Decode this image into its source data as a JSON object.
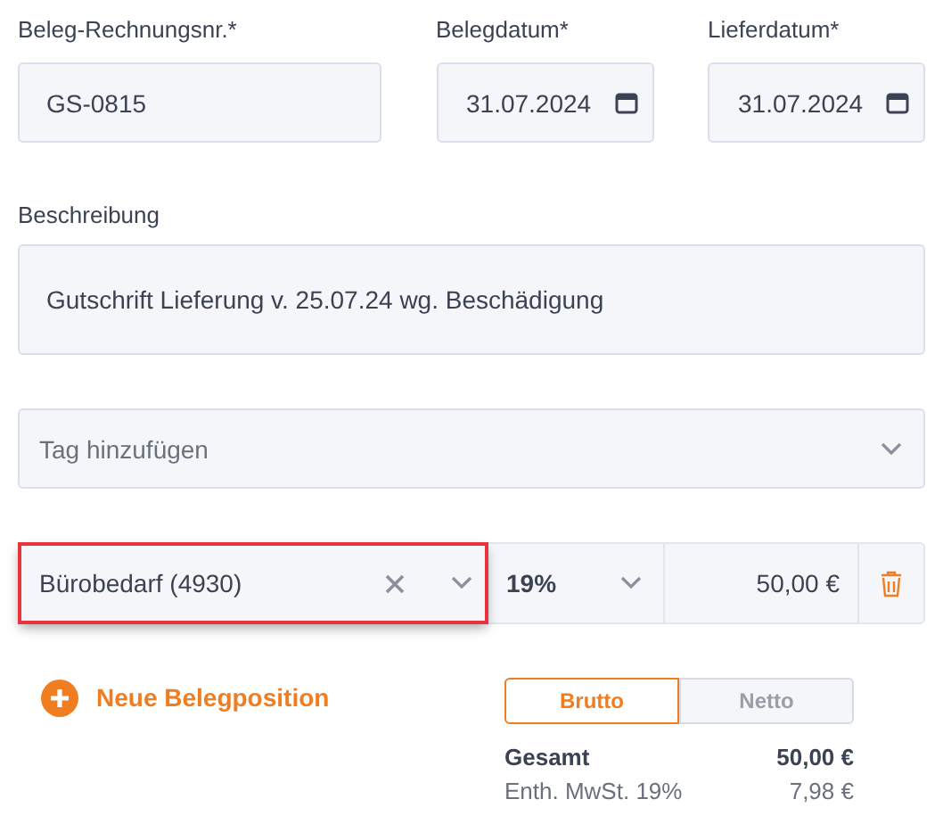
{
  "fields": [
    {
      "label": "Beleg-Rechnungsnr.*",
      "value": "GS-0815",
      "kind": "text"
    },
    {
      "label": "Belegdatum*",
      "value": "31.07.2024",
      "kind": "date"
    },
    {
      "label": "Lieferdatum*",
      "value": "31.07.2024",
      "kind": "date"
    }
  ],
  "description": {
    "label": "Beschreibung",
    "value": "Gutschrift Lieferung v. 25.07.24 wg. Beschädigung"
  },
  "tags": {
    "placeholder": "Tag hinzufügen"
  },
  "positions": [
    {
      "category": "Bürobedarf (4930)",
      "tax": "19%",
      "amount": "50,00 €",
      "highlighted": true
    }
  ],
  "add_button": "Neue Belegposition",
  "price_mode": [
    {
      "label": "Brutto",
      "selected": true
    },
    {
      "label": "Netto",
      "selected": false
    }
  ],
  "totals": [
    {
      "label": "Gesamt",
      "value": "50,00 €",
      "kind": "total"
    },
    {
      "label": "Enth. MwSt. 19%",
      "value": "7,98 €",
      "kind": "tax"
    }
  ]
}
